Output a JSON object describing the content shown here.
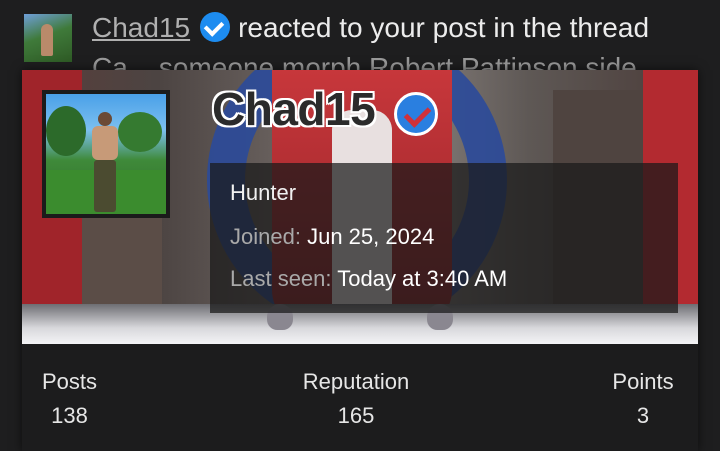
{
  "notification": {
    "username": "Chad15",
    "action_text": "reacted to your post in the thread",
    "thread_title_partial": "Ca... someone morph Robert Pattinson side..."
  },
  "profile": {
    "username": "Chad15",
    "title": "Hunter",
    "joined_label": "Joined:",
    "joined_value": "Jun 25, 2024",
    "last_seen_label": "Last seen:",
    "last_seen_value": "Today at 3:40 AM"
  },
  "stats": [
    {
      "label": "Posts",
      "value": "138"
    },
    {
      "label": "Reputation",
      "value": "165"
    },
    {
      "label": "Points",
      "value": "3"
    }
  ],
  "colors": {
    "background": "#1e1e1f",
    "verified_badge": "#1d8cf0",
    "text": "#ececec"
  }
}
